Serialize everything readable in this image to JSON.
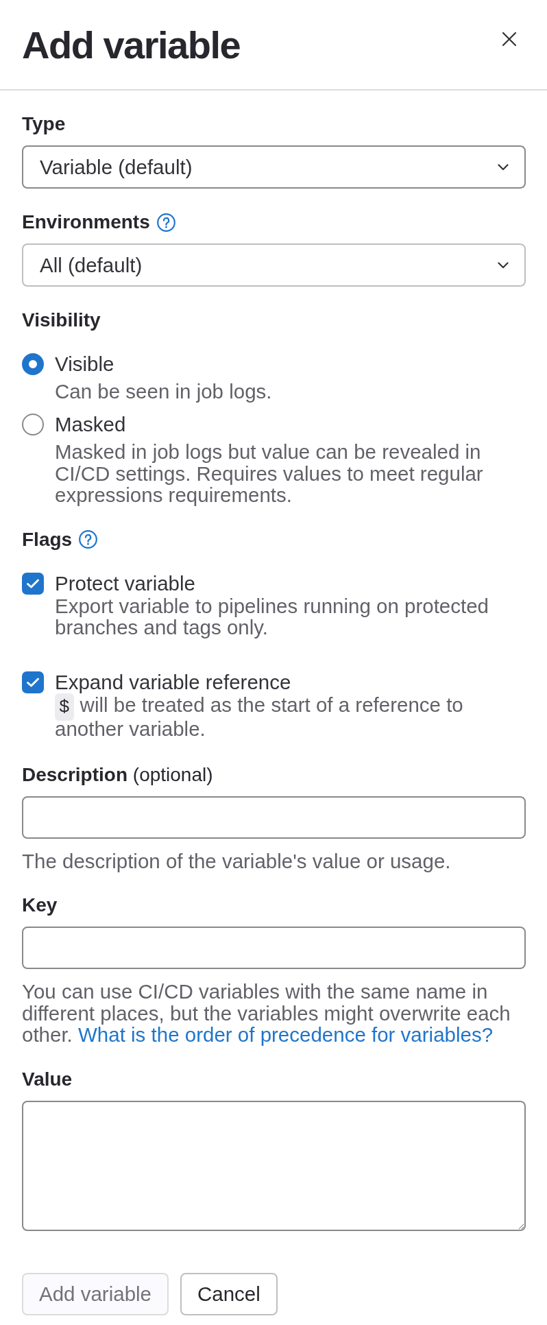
{
  "header": {
    "title": "Add variable"
  },
  "form": {
    "type": {
      "label": "Type",
      "value": "Variable (default)"
    },
    "environments": {
      "label": "Environments",
      "value": "All (default)"
    },
    "visibility": {
      "label": "Visibility",
      "options": [
        {
          "label": "Visible",
          "description": "Can be seen in job logs.",
          "selected": true
        },
        {
          "label": "Masked",
          "description": "Masked in job logs but value can be revealed in CI/CD settings. Requires values to meet regular expressions requirements.",
          "selected": false
        }
      ]
    },
    "flags": {
      "label": "Flags",
      "options": [
        {
          "label": "Protect variable",
          "description": "Export variable to pipelines running on protected branches and tags only.",
          "checked": true
        },
        {
          "label": "Expand variable reference",
          "code": "$",
          "description": "will be treated as the start of a reference to another variable.",
          "checked": true
        }
      ]
    },
    "description": {
      "label": "**Description** (optional)",
      "help": "The description of the variable's value or usage."
    },
    "key": {
      "label": "Key",
      "help": "You can use CI/CD variables with the same name in different places, but the variables might overwrite each other.",
      "link": "What is the order of precedence for variables?"
    },
    "value": {
      "label": "Value"
    }
  },
  "buttons": [
    {
      "label": "Add variable",
      "disabled": true
    },
    {
      "label": "Cancel",
      "disabled": false
    }
  ]
}
